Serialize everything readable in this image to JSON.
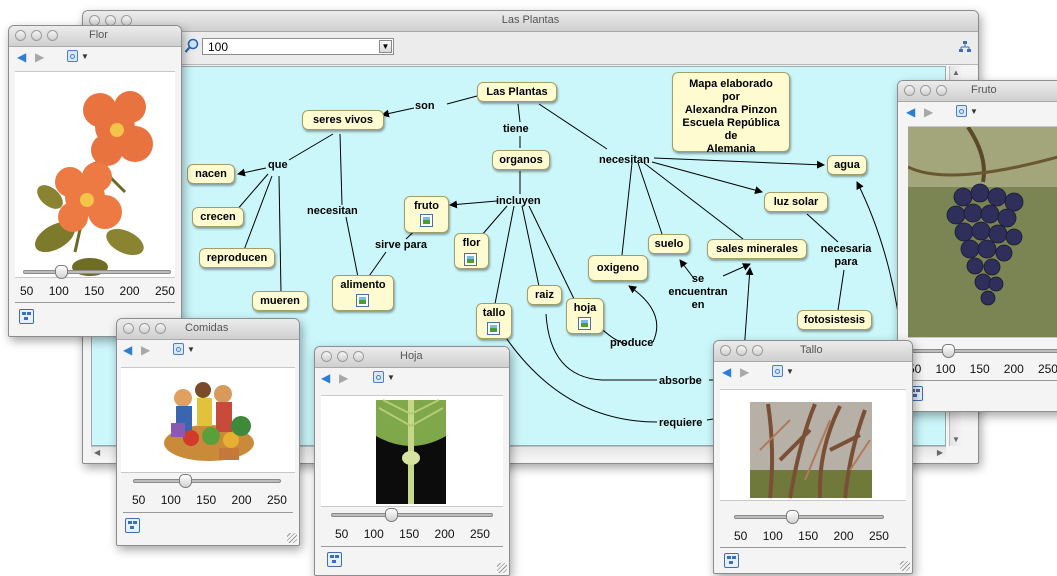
{
  "main_window": {
    "title": "Las Plantas",
    "zoom_value": "100",
    "canvas_bg": "#cbf7fb"
  },
  "concept_map": {
    "nodes": {
      "las_plantas": "Las Plantas",
      "seres_vivos": "seres vivos",
      "organos": "organos",
      "nacen": "nacen",
      "crecen": "crecen",
      "reproducen": "reproducen",
      "mueren": "mueren",
      "fruto": "fruto",
      "alimento": "alimento",
      "flor": "flor",
      "tallo": "tallo",
      "raiz": "raiz",
      "hoja": "hoja",
      "oxigeno": "oxigeno",
      "suelo": "suelo",
      "sales_minerales": "sales minerales",
      "agua": "agua",
      "luz_solar": "luz solar",
      "fotosistesis": "fotosistesis"
    },
    "note_lines": [
      "Mapa elaborado por",
      "Alexandra Pinzon",
      "Escuela República de",
      "Alemania"
    ],
    "links": {
      "son": "son",
      "tiene": "tiene",
      "que": "que",
      "necesitan_left": "necesitan",
      "necesitan_right": "necesitan",
      "incluyen": "incluyen",
      "sirve_para": "sirve para",
      "se_encuentran_en": [
        "se",
        "encuentran",
        "en"
      ],
      "necesaria_para": [
        "necesaria",
        "para"
      ],
      "produce": "produce",
      "absorbe": "absorbe",
      "requiere": "requiere"
    }
  },
  "resource_windows": {
    "flor": {
      "title": "Flor",
      "ticks": [
        "50",
        "100",
        "150",
        "200",
        "250"
      ],
      "zoom_level": 100
    },
    "fruto": {
      "title": "Fruto",
      "ticks": [
        "50",
        "100",
        "150",
        "200",
        "250"
      ],
      "zoom_level": 100
    },
    "comidas": {
      "title": "Comidas",
      "ticks": [
        "50",
        "100",
        "150",
        "200",
        "250"
      ],
      "zoom_level": 125
    },
    "hoja": {
      "title": "Hoja",
      "ticks": [
        "50",
        "100",
        "150",
        "200",
        "250"
      ],
      "zoom_level": 125
    },
    "tallo": {
      "title": "Tallo",
      "ticks": [
        "50",
        "100",
        "150",
        "200",
        "250"
      ],
      "zoom_level": 125
    }
  },
  "colors": {
    "node_fill": "#fefbd0",
    "node_border": "#a39e68",
    "link_line": "#000000",
    "nav_back": "#2a7ed6"
  },
  "icons": [
    "back-arrow-icon",
    "forward-arrow-icon",
    "picture-menu-icon",
    "map-view-icon",
    "zoom-magnifier-icon",
    "resource-image-icon"
  ]
}
